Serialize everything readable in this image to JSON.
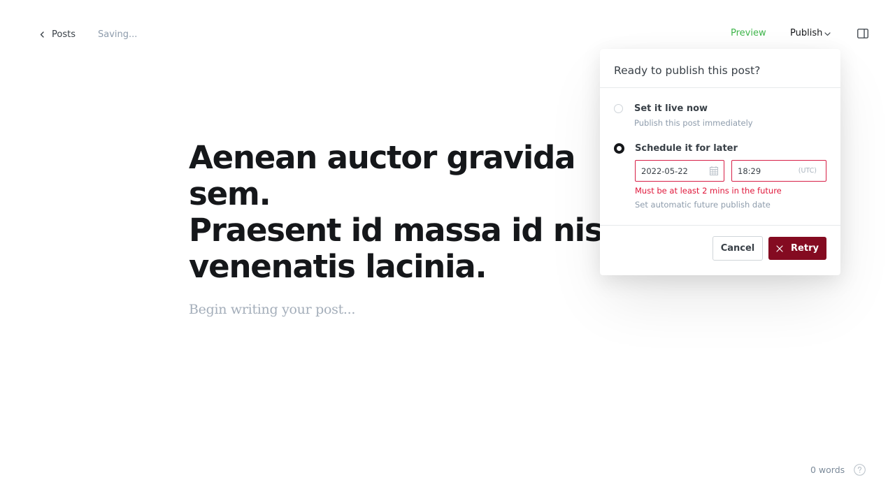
{
  "header": {
    "back_label": "Posts",
    "status": "Saving...",
    "preview_label": "Preview",
    "publish_label": "Publish"
  },
  "editor": {
    "title": "Aenean auctor gravida sem.\nPraesent id massa id nisl\nvenenatis lacinia.",
    "body_placeholder": "Begin writing your post..."
  },
  "publish_menu": {
    "title": "Ready to publish this post?",
    "options": [
      {
        "label": "Set it live now",
        "description": "Publish this post immediately",
        "selected": false
      },
      {
        "label": "Schedule it for later",
        "description": "Set automatic future publish date",
        "selected": true
      }
    ],
    "date_value": "2022-05-22",
    "time_value": "18:29",
    "timezone": "(UTC)",
    "error": "Must be at least 2 mins in the future",
    "cancel_label": "Cancel",
    "retry_label": "Retry"
  },
  "footer": {
    "word_count": "0 words"
  },
  "colors": {
    "preview_green": "#3eb54a",
    "retry_bg": "#840b21",
    "error_red": "#e0163a"
  }
}
